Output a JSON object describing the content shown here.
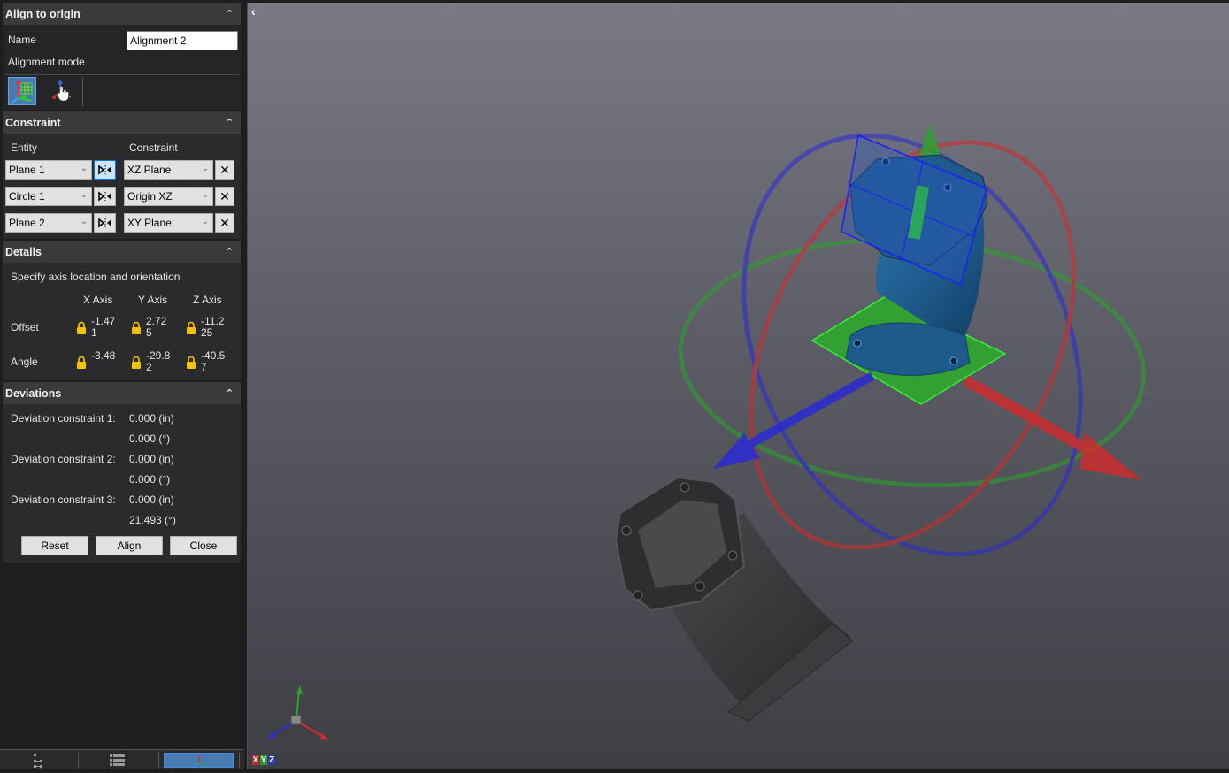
{
  "panel": {
    "title": "Align to origin",
    "name_label": "Name",
    "name_value": "Alignment 2",
    "alignment_mode_label": "Alignment mode",
    "modes": [
      {
        "name": "constraint-based-alignment",
        "icon": "axis-grid-icon",
        "active": true
      },
      {
        "name": "interactive-alignment",
        "icon": "axis-hand-icon",
        "active": false
      }
    ]
  },
  "constraint": {
    "title": "Constraint",
    "entity_header": "Entity",
    "constraint_header": "Constraint",
    "rows": [
      {
        "entity": "Plane 1",
        "constraint": "XZ Plane",
        "flip_selected": true
      },
      {
        "entity": "Circle 1",
        "constraint": "Origin XZ",
        "flip_selected": false
      },
      {
        "entity": "Plane 2",
        "constraint": "XY Plane",
        "flip_selected": false
      }
    ],
    "remove_glyph": "✕",
    "flip_glyph": "▷⋮◀"
  },
  "details": {
    "title": "Details",
    "description": "Specify axis location and orientation",
    "axes": [
      "X Axis",
      "Y Axis",
      "Z Axis"
    ],
    "offset_label": "Offset",
    "angle_label": "Angle",
    "offset": [
      "-1.471",
      "2.725",
      "-11.225"
    ],
    "angle": [
      "-3.48",
      "-29.82",
      "-40.57"
    ],
    "lock_color": "#f2c200"
  },
  "deviations": {
    "title": "Deviations",
    "items": [
      {
        "label": "Deviation constraint 1:",
        "distance": "0.000 (in)",
        "angle": "0.000 (°)"
      },
      {
        "label": "Deviation constraint 2:",
        "distance": "0.000 (in)",
        "angle": "0.000 (°)"
      },
      {
        "label": "Deviation constraint 3:",
        "distance": "0.000 (in)",
        "angle": "21.493 (°)"
      }
    ]
  },
  "actions": {
    "reset": "Reset",
    "align": "Align",
    "close": "Close"
  },
  "bottom_tabs": [
    {
      "name": "tree-view-tab",
      "icon": "tree-icon",
      "active": false
    },
    {
      "name": "list-view-tab",
      "icon": "list-icon",
      "active": false
    },
    {
      "name": "alignment-tab",
      "icon": "axis-icon",
      "active": true
    }
  ],
  "viewport": {
    "collapse_glyph": "‹",
    "axis_letters": [
      "X",
      "Y",
      "Z"
    ],
    "colors": {
      "x_axis": "#d42a2a",
      "y_axis": "#2aa52a",
      "z_axis": "#2a2ad4",
      "aligned_part": "#1e5a8c",
      "original_part": "#3a3a3a",
      "accent": "#4a7bb0"
    }
  }
}
